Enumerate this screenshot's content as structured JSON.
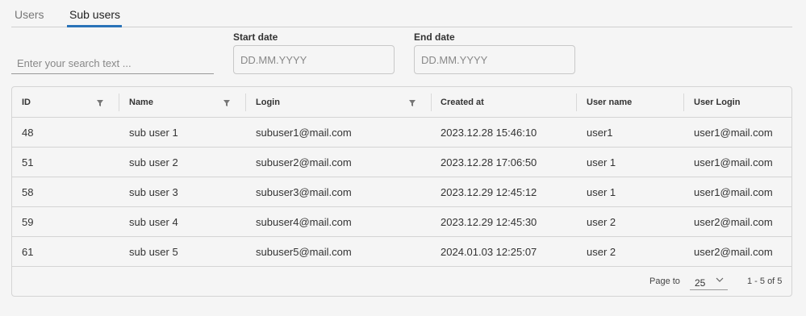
{
  "tabs": [
    {
      "label": "Users",
      "active": false
    },
    {
      "label": "Sub users",
      "active": true
    }
  ],
  "filters": {
    "search_placeholder": "Enter your search text ...",
    "start_date_label": "Start date",
    "start_date_placeholder": "DD.MM.YYYY",
    "end_date_label": "End date",
    "end_date_placeholder": "DD.MM.YYYY"
  },
  "table": {
    "columns": [
      "ID",
      "Name",
      "Login",
      "Created at",
      "User name",
      "User Login"
    ],
    "rows": [
      {
        "id": "48",
        "name": "sub user 1",
        "login": "subuser1@mail.com",
        "created": "2023.12.28 15:46:10",
        "user_name": "user1",
        "user_login": "user1@mail.com"
      },
      {
        "id": "51",
        "name": "sub user 2",
        "login": "subuser2@mail.com",
        "created": "2023.12.28 17:06:50",
        "user_name": "user 1",
        "user_login": "user1@mail.com"
      },
      {
        "id": "58",
        "name": "sub user 3",
        "login": "subuser3@mail.com",
        "created": "2023.12.29 12:45:12",
        "user_name": "user 1",
        "user_login": "user1@mail.com"
      },
      {
        "id": "59",
        "name": "sub user 4",
        "login": "subuser4@mail.com",
        "created": "2023.12.29 12:45:30",
        "user_name": "user 2",
        "user_login": "user2@mail.com"
      },
      {
        "id": "61",
        "name": "sub user 5",
        "login": "subuser5@mail.com",
        "created": "2024.01.03 12:25:07",
        "user_name": "user 2",
        "user_login": "user2@mail.com"
      }
    ]
  },
  "pagination": {
    "page_to_label": "Page to",
    "page_size": "25",
    "range_text": "1 - 5 of 5"
  },
  "colors": {
    "accent": "#2a73b8",
    "background": "#f5f5f5"
  },
  "icons": {
    "column_filter": "filter-funnel-icon",
    "select_chevron": "chevron-down-icon"
  }
}
